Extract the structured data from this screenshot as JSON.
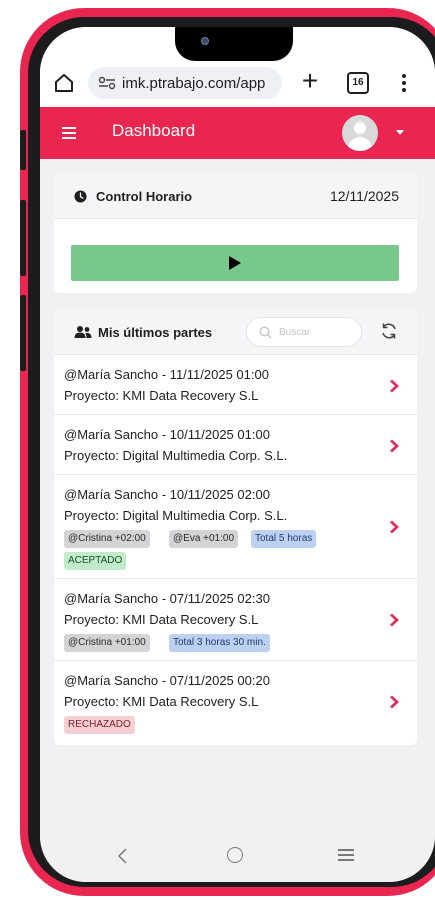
{
  "browser": {
    "url": "imk.ptrabajo.com/app",
    "tab_count": "16"
  },
  "header": {
    "title": "Dashboard"
  },
  "control": {
    "title": "Control Horario",
    "date": "12/11/2025"
  },
  "parts": {
    "title": "Mis últimos partes",
    "search_placeholder": "Buscar",
    "items": [
      {
        "line1": "@María Sancho - 11/11/2025 01:00",
        "line2": "Proyecto: KMI Data Recovery S.L"
      },
      {
        "line1": "@María Sancho - 10/11/2025 01:00",
        "line2": "Proyecto: Digital Multimedia Corp. S.L."
      },
      {
        "line1": "@María Sancho - 10/11/2025 02:00",
        "line2": "Proyecto: Digital Multimedia Corp. S.L.",
        "tags": [
          "@Cristina +02:00",
          "@Eva +01:00",
          "Total 5 horas"
        ],
        "status": "ACEPTADO"
      },
      {
        "line1": "@María Sancho - 07/11/2025 02:30",
        "line2": "Proyecto: KMI Data Recovery S.L",
        "tags": [
          "@Cristina +01:00",
          "Total 3 horas 30 min."
        ]
      },
      {
        "line1": "@María Sancho - 07/11/2025 00:20",
        "line2": "Proyecto: KMI Data Recovery S.L",
        "status": "RECHAZADO"
      }
    ]
  },
  "colors": {
    "brand": "#e8264f",
    "play_button": "#77c88a"
  }
}
